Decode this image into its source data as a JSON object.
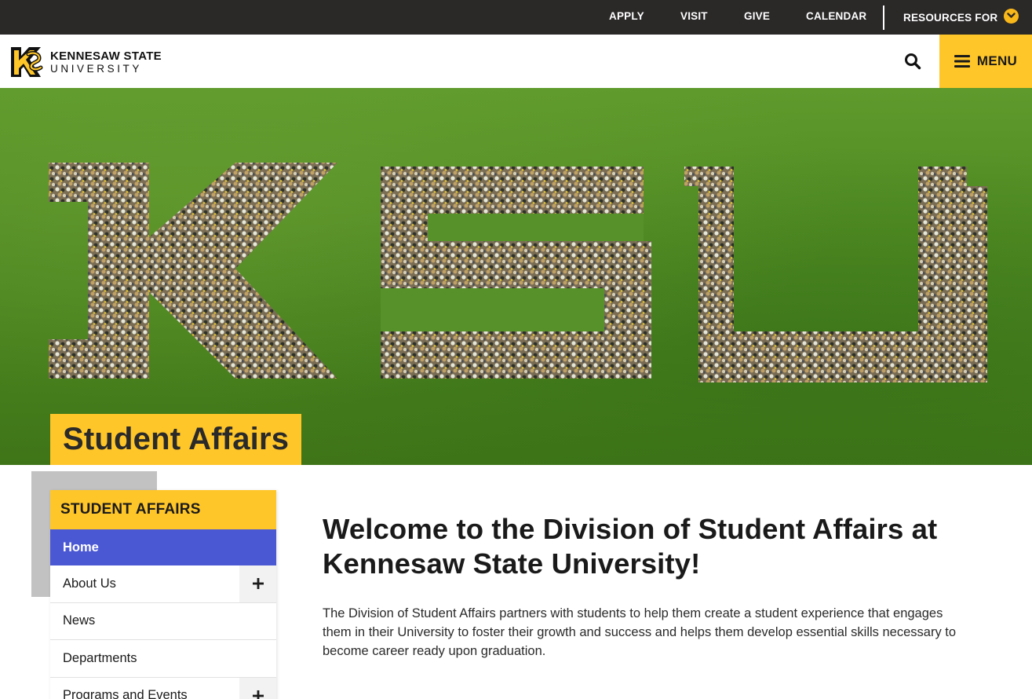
{
  "utility_nav": {
    "links": [
      {
        "label": "APPLY"
      },
      {
        "label": "VISIT"
      },
      {
        "label": "GIVE"
      },
      {
        "label": "CALENDAR"
      }
    ],
    "resources_label": "RESOURCES FOR"
  },
  "header": {
    "logo_line1": "KENNESAW STATE",
    "logo_line2": "UNIVERSITY",
    "menu_label": "MENU"
  },
  "hero": {
    "title": "Student Affairs"
  },
  "sidebar": {
    "heading": "STUDENT AFFAIRS",
    "items": [
      {
        "label": "Home",
        "active": true,
        "expandable": false
      },
      {
        "label": "About Us",
        "active": false,
        "expandable": true
      },
      {
        "label": "News",
        "active": false,
        "expandable": false
      },
      {
        "label": "Departments",
        "active": false,
        "expandable": false
      },
      {
        "label": "Programs and Events",
        "active": false,
        "expandable": true
      }
    ]
  },
  "main": {
    "heading": "Welcome to the Division of Student Affairs at Kennesaw State University!",
    "intro": "The Division of Student Affairs partners with students to help them create a student experience that engages them in their University to foster their growth and success and helps them develop essential skills necessary to become career ready upon graduation."
  },
  "colors": {
    "gold": "#ffc629",
    "utility_bar": "#2b2828",
    "active_nav": "#4b58d4",
    "grass": "#4f8a22"
  },
  "icons": {
    "search": "search-icon",
    "menu": "hamburger-icon",
    "resources": "chevron-down-icon",
    "expand": "plus-icon"
  }
}
